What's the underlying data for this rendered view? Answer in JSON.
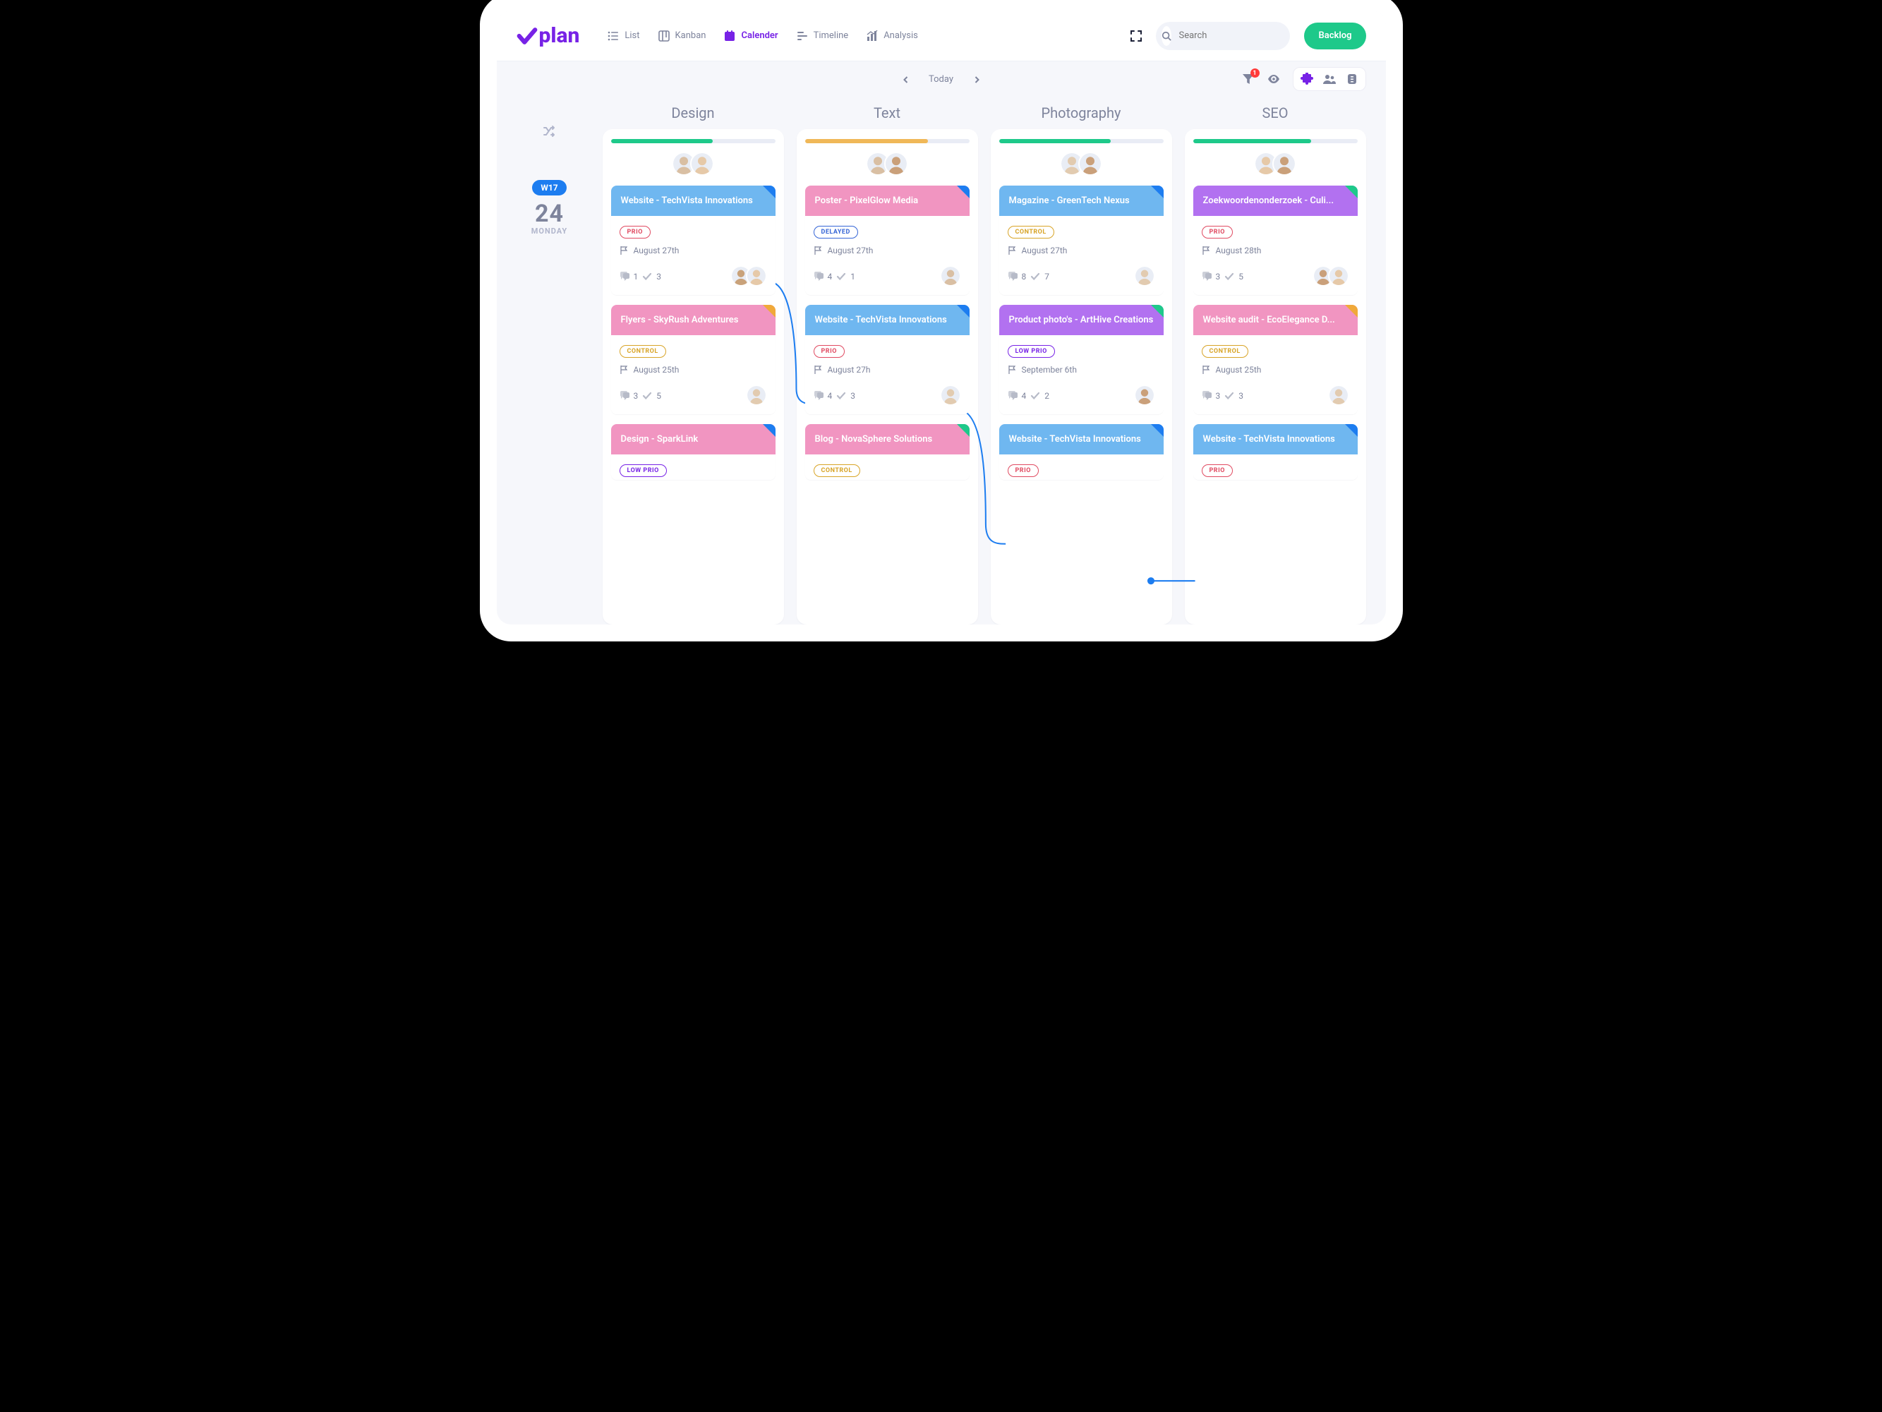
{
  "logo_text": "plan",
  "nav": {
    "list": "List",
    "kanban": "Kanban",
    "calender": "Calender",
    "timeline": "Timeline",
    "analysis": "Analysis"
  },
  "search": {
    "placeholder": "Search"
  },
  "backlog_btn": "Backlog",
  "date_nav": {
    "label": "Today"
  },
  "filter_badge": "1",
  "day": {
    "week": "W17",
    "num": "24",
    "name": "MONDAY"
  },
  "columns": [
    {
      "title": "Design",
      "progress": {
        "pct": 62,
        "color": "#1ec98a"
      },
      "avatars": [
        "#d9bfa3",
        "#e6c9a8"
      ],
      "cards": [
        {
          "head_color": "blue",
          "corner": "blue",
          "title": "Website - TechVista Innovations",
          "tag": {
            "type": "prio",
            "label": "PRIO"
          },
          "date": "August 27th",
          "comments": "1",
          "checks": "3",
          "assignees": [
            "#c9a27a",
            "#e6c9a8"
          ]
        },
        {
          "head_color": "pink",
          "corner": "orange",
          "title": "Flyers - SkyRush Adventures",
          "tag": {
            "type": "control",
            "label": "CONTROL"
          },
          "date": "August 25th",
          "comments": "3",
          "checks": "5",
          "assignees": [
            "#e2cbb0"
          ]
        },
        {
          "head_color": "pink",
          "corner": "blue",
          "title": "Design - SparkLink",
          "tag": {
            "type": "lowprio",
            "label": "LOW PRIO"
          },
          "cut": true
        }
      ]
    },
    {
      "title": "Text",
      "progress": {
        "pct": 75,
        "color": "#f0b858"
      },
      "avatars": [
        "#d9bfa3",
        "#caa07a"
      ],
      "cards": [
        {
          "head_color": "pink",
          "corner": "blue",
          "title": "Poster - PixelGlow Media",
          "tag": {
            "type": "delayed",
            "label": "DELAYED"
          },
          "date": "August 27th",
          "comments": "4",
          "checks": "1",
          "assignees": [
            "#d9bfa3"
          ]
        },
        {
          "head_color": "blue",
          "corner": "blue",
          "title": "Website - TechVista Innovations",
          "tag": {
            "type": "prio",
            "label": "PRIO"
          },
          "date": "August 27h",
          "comments": "4",
          "checks": "3",
          "assignees": [
            "#e2cbb0"
          ]
        },
        {
          "head_color": "pink",
          "corner": "teal",
          "title": "Blog - NovaSphere Solutions",
          "tag": {
            "type": "control",
            "label": "CONTROL"
          },
          "cut": true
        }
      ]
    },
    {
      "title": "Photography",
      "progress": {
        "pct": 68,
        "color": "#1ec98a"
      },
      "avatars": [
        "#e2cbb0",
        "#caa07a"
      ],
      "cards": [
        {
          "head_color": "blue",
          "corner": "blue",
          "title": "Magazine - GreenTech Nexus",
          "tag": {
            "type": "control",
            "label": "CONTROL"
          },
          "date": "August 27th",
          "comments": "8",
          "checks": "7",
          "assignees": [
            "#e2cbb0"
          ]
        },
        {
          "head_color": "violet",
          "corner": "teal",
          "title": "Product photo's - ArtHive Creations",
          "tag": {
            "type": "lowprio",
            "label": "LOW PRIO"
          },
          "date": "September 6th",
          "comments": "4",
          "checks": "2",
          "assignees": [
            "#caa07a"
          ]
        },
        {
          "head_color": "blue",
          "corner": "blue",
          "title": "Website - TechVista Innovations",
          "tag": {
            "type": "prio",
            "label": "PRIO"
          },
          "cut": true
        }
      ]
    },
    {
      "title": "SEO",
      "progress": {
        "pct": 72,
        "color": "#1ec98a"
      },
      "avatars": [
        "#e6c9a8",
        "#caa07a"
      ],
      "cards": [
        {
          "head_color": "violet",
          "corner": "teal",
          "title": "Zoekwoordenonderzoek - Culi...",
          "tag": {
            "type": "prio",
            "label": "PRIO"
          },
          "date": "August 28th",
          "comments": "3",
          "checks": "5",
          "assignees": [
            "#caa07a",
            "#e6c9a8"
          ]
        },
        {
          "head_color": "pink",
          "corner": "orange",
          "title": "Website audit -  EcoElegance D...",
          "tag": {
            "type": "control",
            "label": "CONTROL"
          },
          "date": "August 25th",
          "comments": "3",
          "checks": "3",
          "assignees": [
            "#e2cbb0"
          ]
        },
        {
          "head_color": "blue",
          "corner": "blue",
          "title": "Website - TechVista Innovations",
          "tag": {
            "type": "prio",
            "label": "PRIO"
          },
          "cut": true
        }
      ]
    }
  ]
}
